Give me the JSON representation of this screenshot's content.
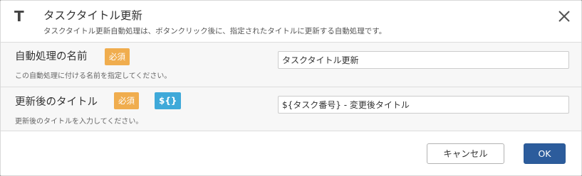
{
  "dialog": {
    "icon_letter": "T",
    "title": "タスクタイトル更新",
    "subtitle": "タスクタイトル更新自動処理は、ボタンクリック後に、指定されたタイトルに更新する自動処理です。",
    "close_icon": "close-icon"
  },
  "fields": [
    {
      "label": "自動処理の名前",
      "required_badge": "必須",
      "help": "この自動処理に付ける名前を指定してください。",
      "value": "タスクタイトル更新"
    },
    {
      "label": "更新後のタイトル",
      "required_badge": "必須",
      "var_badge": "${}",
      "help": "更新後のタイトルを入力してください。",
      "value": "${タスク番号} - 変更後タイトル"
    }
  ],
  "footer": {
    "cancel_label": "キャンセル",
    "ok_label": "OK"
  },
  "colors": {
    "required_badge": "#f0ad4e",
    "var_badge": "#3fa9d9",
    "ok_button": "#2c5c9c"
  }
}
